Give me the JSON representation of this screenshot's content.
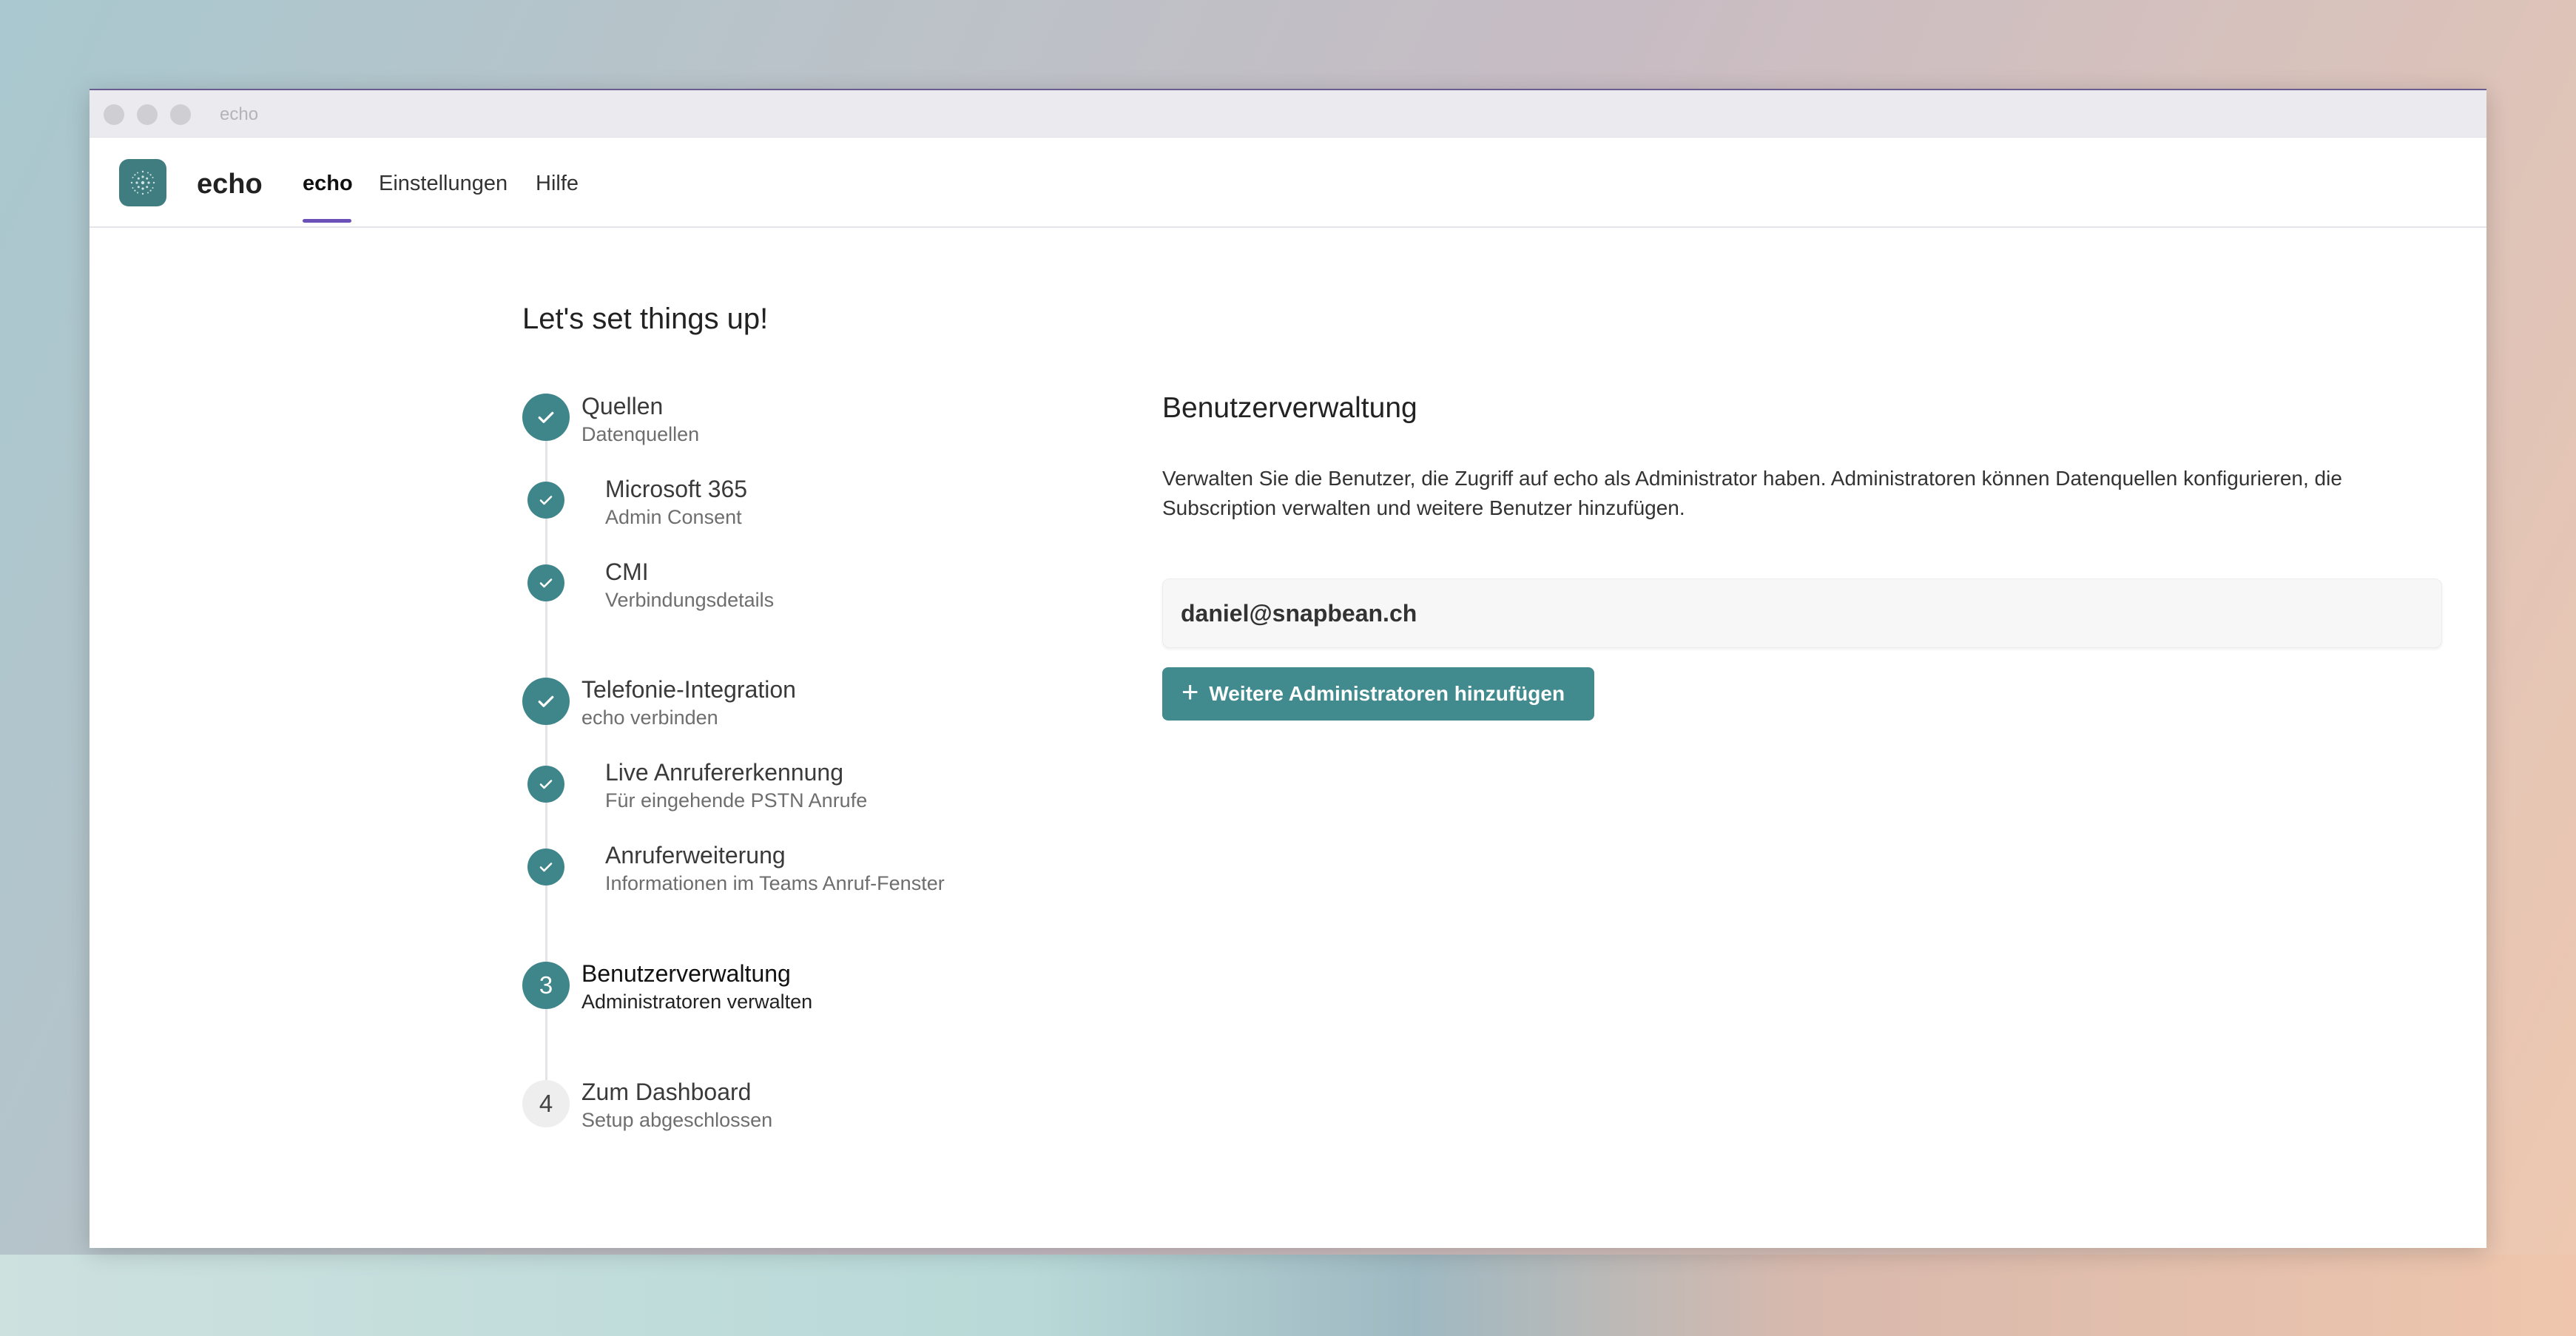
{
  "window": {
    "title": "echo"
  },
  "nav": {
    "brand": "echo",
    "tabs": [
      {
        "label": "echo",
        "active": true
      },
      {
        "label": "Einstellungen",
        "active": false
      },
      {
        "label": "Hilfe",
        "active": false
      }
    ]
  },
  "setup": {
    "heading": "Let's set things up!",
    "steps": [
      {
        "title": "Quellen",
        "subtitle": "Datenquellen",
        "status": "done",
        "icon": "check-icon"
      },
      {
        "title": "Microsoft 365",
        "subtitle": "Admin Consent",
        "status": "done",
        "icon": "check-icon"
      },
      {
        "title": "CMI",
        "subtitle": "Verbindungsdetails",
        "status": "done",
        "icon": "check-icon"
      },
      {
        "title": "Telefonie-Integration",
        "subtitle": "echo verbinden",
        "status": "done",
        "icon": "check-icon"
      },
      {
        "title": "Live Anrufererkennung",
        "subtitle": "Für eingehende PSTN Anrufe",
        "status": "done",
        "icon": "check-icon"
      },
      {
        "title": "Anruferweiterung",
        "subtitle": "Informationen im Teams Anruf-Fenster",
        "status": "done",
        "icon": "check-icon"
      },
      {
        "title": "Benutzerverwaltung",
        "subtitle": "Administratoren verwalten",
        "status": "current",
        "number": "3"
      },
      {
        "title": "Zum Dashboard",
        "subtitle": "Setup abgeschlossen",
        "status": "pending",
        "number": "4"
      }
    ]
  },
  "panel": {
    "title": "Benutzerverwaltung",
    "description": "Verwalten Sie die Benutzer, die Zugriff auf echo als Administrator haben. Administratoren können Datenquellen konfigurieren, die Subscription verwalten und weitere Benutzer hinzufügen.",
    "users": [
      "daniel@snapbean.ch"
    ],
    "add_button": "Weitere Administratoren hinzufügen"
  },
  "colors": {
    "accent": "#3f868b",
    "tab_underline": "#6b50b8"
  }
}
